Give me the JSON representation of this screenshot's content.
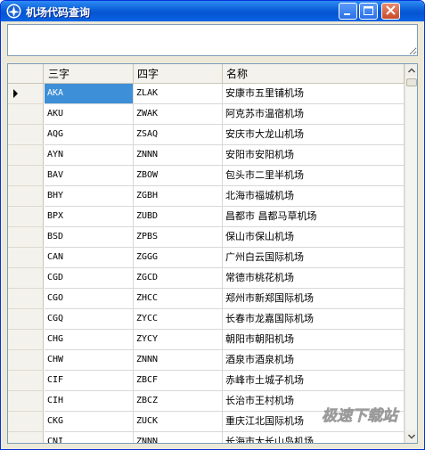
{
  "window": {
    "title": "机场代码查询"
  },
  "search": {
    "value": ""
  },
  "grid": {
    "columns": [
      "三字",
      "四字",
      "名称"
    ],
    "selected_row": 0,
    "rows": [
      [
        "AKA",
        "ZLAK",
        "安康市五里铺机场"
      ],
      [
        "AKU",
        "ZWAK",
        "阿克苏市温宿机场"
      ],
      [
        "AQG",
        "ZSAQ",
        "安庆市大龙山机场"
      ],
      [
        "AYN",
        "ZNNN",
        "安阳市安阳机场"
      ],
      [
        "BAV",
        "ZBOW",
        "包头市二里半机场"
      ],
      [
        "BHY",
        "ZGBH",
        "北海市福城机场"
      ],
      [
        "BPX",
        "ZUBD",
        "昌都市 昌都马草机场"
      ],
      [
        "BSD",
        "ZPBS",
        "保山市保山机场"
      ],
      [
        "CAN",
        "ZGGG",
        "广州白云国际机场"
      ],
      [
        "CGD",
        "ZGCD",
        "常德市桃花机场"
      ],
      [
        "CGO",
        "ZHCC",
        "郑州市新郑国际机场"
      ],
      [
        "CGQ",
        "ZYCC",
        "长春市龙嘉国际机场"
      ],
      [
        "CHG",
        "ZYCY",
        "朝阳市朝阳机场"
      ],
      [
        "CHW",
        "ZNNN",
        "酒泉市酒泉机场"
      ],
      [
        "CIF",
        "ZBCF",
        "赤峰市土城子机场"
      ],
      [
        "CIH",
        "ZBCZ",
        "长治市王村机场"
      ],
      [
        "CKG",
        "ZUCK",
        "重庆江北国际机场"
      ],
      [
        "CNI",
        "ZNNN",
        "长海市大长山岛机场"
      ]
    ]
  },
  "watermark": {
    "text": "极速下载站"
  },
  "icons": {
    "app": "app-logo-icon",
    "minimize": "minimize-icon",
    "maximize": "maximize-icon",
    "close": "close-icon",
    "row_pointer": "current-row-pointer-icon",
    "scroll_up": "scroll-up-arrow-icon",
    "scroll_down": "scroll-down-arrow-icon"
  },
  "colors": {
    "titlebar": "#0a5fd8",
    "selection": "#3d8fd8"
  }
}
